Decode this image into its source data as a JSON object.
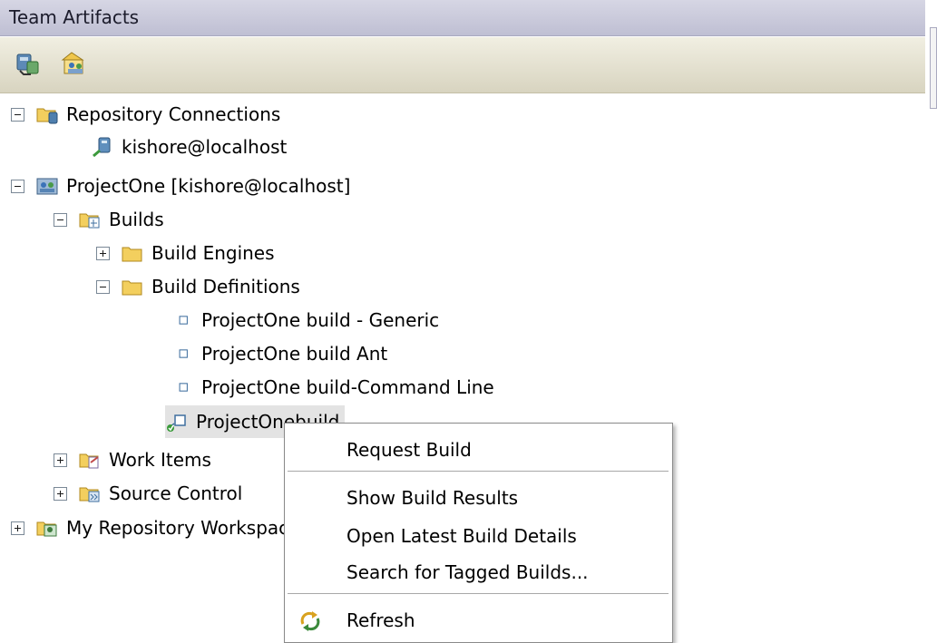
{
  "panel": {
    "title": "Team Artifacts"
  },
  "toolbar": {
    "buttons": [
      {
        "icon": "connect-repository-icon"
      },
      {
        "icon": "accept-team-invitation-icon"
      }
    ]
  },
  "tree": {
    "repository_connections": "Repository Connections",
    "connection": "kishore@localhost",
    "project": "ProjectOne [kishore@localhost]",
    "builds": "Builds",
    "build_engines": "Build Engines",
    "build_definitions": "Build Definitions",
    "definitions": [
      "ProjectOne build - Generic",
      "ProjectOne build Ant",
      "ProjectOne build-Command Line",
      "ProjectOnebuild"
    ],
    "work_items": "Work Items",
    "source_control": "Source Control",
    "my_repository_workspaces": "My Repository Workspaces"
  },
  "context_menu": {
    "items": [
      "Request Build",
      "Show Build Results",
      "Open Latest Build Details",
      "Search for Tagged Builds...",
      "Refresh"
    ],
    "refresh_icon": "refresh-icon"
  },
  "colors": {
    "title_bar": "#c8c8da",
    "toolbar": "#e6e3d3",
    "folder": "#f3cf5e",
    "tree_icon_blue": "#3f6f9f",
    "selection": "#e3e3e3"
  }
}
